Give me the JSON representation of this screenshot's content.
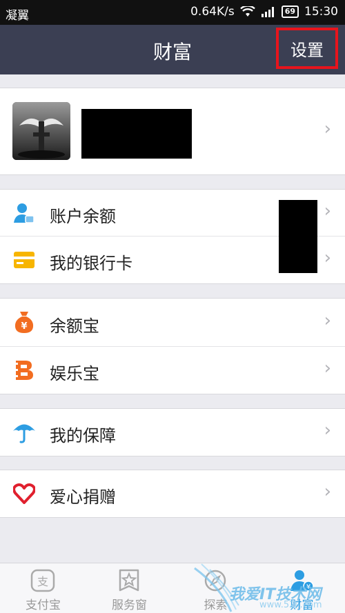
{
  "status_bar": {
    "carrier": "凝翼",
    "speed": "0.64K/s",
    "battery": "69",
    "time": "15:30"
  },
  "nav": {
    "title": "财富",
    "settings_label": "设置"
  },
  "profile": {
    "chevron": "›"
  },
  "menu": {
    "balance": {
      "label": "账户余额",
      "icon": "user-balance-icon"
    },
    "bank_card": {
      "label": "我的银行卡",
      "icon": "card-icon"
    },
    "yuebao": {
      "label": "余额宝",
      "icon": "money-bag-icon"
    },
    "yulebao": {
      "label": "娱乐宝",
      "icon": "film-b-icon"
    },
    "insurance": {
      "label": "我的保障",
      "icon": "umbrella-icon"
    },
    "charity": {
      "label": "爱心捐赠",
      "icon": "heart-icon"
    },
    "chevron": "›"
  },
  "tabs": [
    {
      "label": "支付宝",
      "icon": "alipay-icon"
    },
    {
      "label": "服务窗",
      "icon": "star-icon"
    },
    {
      "label": "探索",
      "icon": "explore-icon"
    },
    {
      "label": "财富",
      "icon": "wealth-icon"
    }
  ],
  "watermark": {
    "text": "我爱IT技术网",
    "url": "www.52ij.com"
  },
  "colors": {
    "nav_bg": "#3b3f53",
    "accent": "#2d9de2",
    "highlight_box": "#e8141c",
    "orange": "#f26d21",
    "yellow": "#f7b500"
  }
}
